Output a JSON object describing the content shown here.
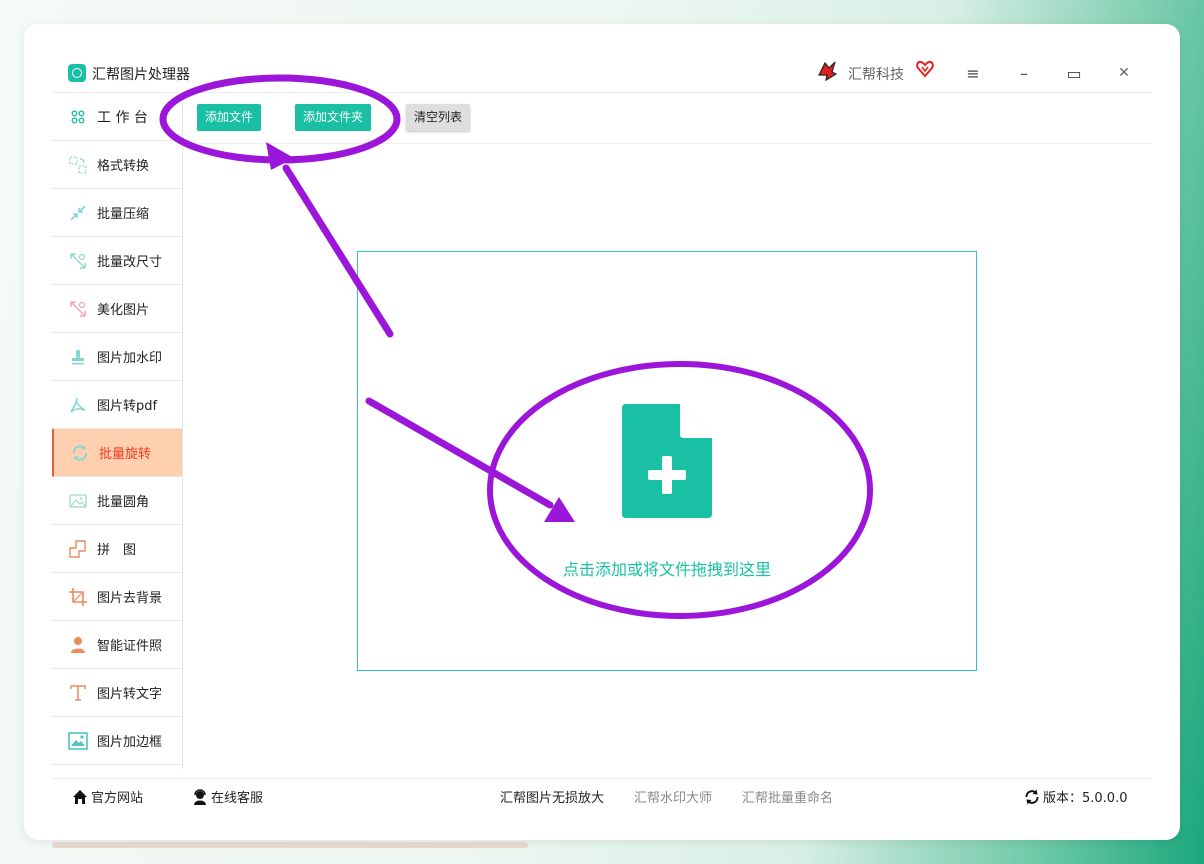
{
  "app": {
    "title": "汇帮图片处理器",
    "brand": "汇帮科技"
  },
  "window_controls": {
    "menu": "≡",
    "minimize": "–",
    "maximize": "▭",
    "close": "✕"
  },
  "sidebar": {
    "items": [
      {
        "label": "工 作 台",
        "icon": "grid-icon",
        "color": "#19c0a4"
      },
      {
        "label": "格式转换",
        "icon": "format-convert-icon",
        "color": "#8fd8cc"
      },
      {
        "label": "批量压缩",
        "icon": "compress-icon",
        "color": "#7fd6d2"
      },
      {
        "label": "批量改尺寸",
        "icon": "resize-icon",
        "color": "#8fd8cc"
      },
      {
        "label": "美化图片",
        "icon": "beautify-icon",
        "color": "#f0a0c0"
      },
      {
        "label": "图片加水印",
        "icon": "stamp-icon",
        "color": "#7fd6d2"
      },
      {
        "label": "图片转pdf",
        "icon": "pdf-icon",
        "color": "#7fd6d2"
      },
      {
        "label": "批量旋转",
        "icon": "rotate-icon",
        "color": "#7fd6d2",
        "active": true
      },
      {
        "label": "批量圆角",
        "icon": "image-icon",
        "color": "#9fd8d4"
      },
      {
        "label": "拼　图",
        "icon": "collage-icon",
        "color": "#ee8a5c"
      },
      {
        "label": "图片去背景",
        "icon": "crop-icon",
        "color": "#ee8a5c"
      },
      {
        "label": "智能证件照",
        "icon": "person-icon",
        "color": "#ee8a5c"
      },
      {
        "label": "图片转文字",
        "icon": "text-icon",
        "color": "#ee8a5c"
      },
      {
        "label": "图片加边框",
        "icon": "frame-icon",
        "color": "#4fc3c0"
      }
    ]
  },
  "toolbar": {
    "add_file": "添加文件",
    "add_folder": "添加文件夹",
    "clear_list": "清空列表"
  },
  "dropzone": {
    "hint": "点击添加或将文件拖拽到这里"
  },
  "footer": {
    "website": "官方网站",
    "support": "在线客服",
    "links": [
      "汇帮图片无损放大",
      "汇帮水印大师",
      "汇帮批量重命名"
    ],
    "version": "版本：5.0.0.0"
  },
  "colors": {
    "accent": "#19c0a4",
    "active_bg": "#ffd0b0",
    "active_text": "#ef3b1f",
    "annotation": "#9b16d8"
  }
}
